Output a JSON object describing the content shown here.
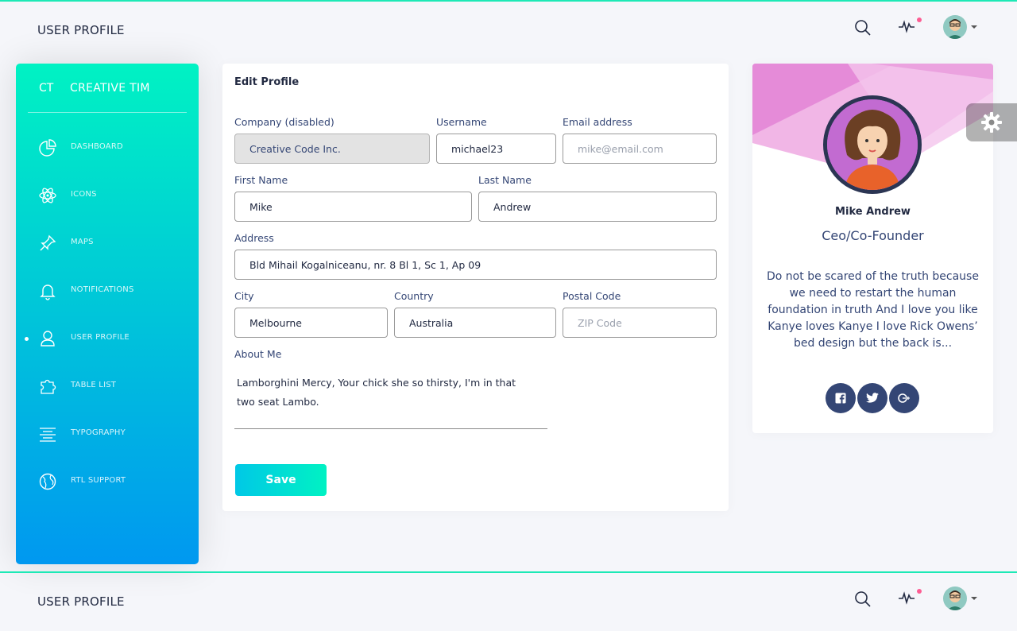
{
  "navbar": {
    "title": "USER PROFILE",
    "icons": [
      "search-icon",
      "activity-icon",
      "avatar"
    ],
    "notification_color": "#fd5d93"
  },
  "sidebar": {
    "logo_mini": "CT",
    "logo_text": "CREATIVE TIM",
    "items": [
      {
        "label": "DASHBOARD",
        "icon": "chart-pie-icon"
      },
      {
        "label": "ICONS",
        "icon": "atom-icon"
      },
      {
        "label": "MAPS",
        "icon": "pin-icon"
      },
      {
        "label": "NOTIFICATIONS",
        "icon": "bell-icon"
      },
      {
        "label": "USER PROFILE",
        "icon": "user-icon",
        "active": true
      },
      {
        "label": "TABLE LIST",
        "icon": "puzzle-icon"
      },
      {
        "label": "TYPOGRAPHY",
        "icon": "align-center-icon"
      },
      {
        "label": "RTL SUPPORT",
        "icon": "world-icon"
      }
    ],
    "gradient": [
      "#00f2c3",
      "#0098f0"
    ]
  },
  "edit_profile": {
    "title": "Edit Profile",
    "company": {
      "label": "Company (disabled)",
      "value": "Creative Code Inc."
    },
    "username": {
      "label": "Username",
      "value": "michael23"
    },
    "email": {
      "label": "Email address",
      "placeholder": "mike@email.com"
    },
    "first_name": {
      "label": "First Name",
      "value": "Mike"
    },
    "last_name": {
      "label": "Last Name",
      "value": "Andrew"
    },
    "address": {
      "label": "Address",
      "value": "Bld Mihail Kogalniceanu, nr. 8 Bl 1, Sc 1, Ap 09"
    },
    "city": {
      "label": "City",
      "value": "Melbourne"
    },
    "country": {
      "label": "Country",
      "value": "Australia"
    },
    "postal": {
      "label": "Postal Code",
      "placeholder": "ZIP Code"
    },
    "about": {
      "label": "About Me",
      "value": "Lamborghini Mercy, Your chick she so thirsty, I'm in that two seat Lambo."
    },
    "save_label": "Save"
  },
  "profile_card": {
    "name": "Mike Andrew",
    "role": "Ceo/Co-Founder",
    "description": "Do not be scared of the truth because we need to restart the human foundation in truth And I love you like Kanye loves Kanye I love Rick Owens’ bed design but the back is...",
    "social": [
      "facebook-icon",
      "twitter-icon",
      "google-plus-icon"
    ]
  },
  "footer_navbar": {
    "title": "USER PROFILE"
  }
}
